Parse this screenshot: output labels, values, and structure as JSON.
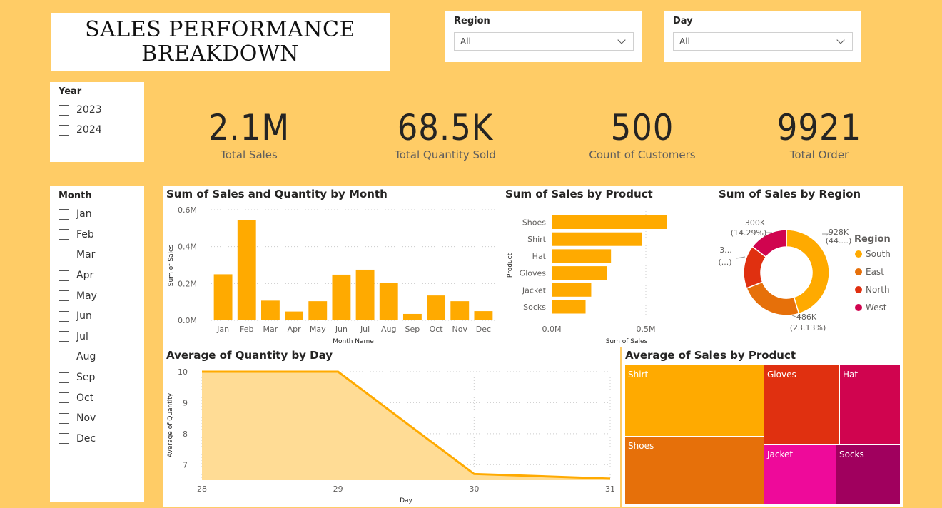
{
  "header": {
    "title_line1": "SALES PERFORMANCE",
    "title_line2": "BREAKDOWN"
  },
  "region_slicer": {
    "label": "Region",
    "value": "All"
  },
  "day_slicer": {
    "label": "Day",
    "value": "All"
  },
  "year_slicer": {
    "label": "Year",
    "options": [
      "2023",
      "2024"
    ]
  },
  "month_slicer": {
    "label": "Month",
    "options": [
      "Jan",
      "Feb",
      "Mar",
      "Apr",
      "May",
      "Jun",
      "Jul",
      "Aug",
      "Sep",
      "Oct",
      "Nov",
      "Dec"
    ]
  },
  "kpis": [
    {
      "value": "2.1M",
      "caption": "Total Sales"
    },
    {
      "value": "68.5K",
      "caption": "Total Quantity Sold"
    },
    {
      "value": "500",
      "caption": "Count of Customers"
    },
    {
      "value": "9921",
      "caption": "Total Order"
    }
  ],
  "colors": {
    "background": "#FFCC66",
    "bar": "#FFAA00",
    "south": "#FFAA00",
    "east": "#E6700A",
    "north": "#E03010",
    "west": "#D0044F",
    "jacket": "#EE0A9A",
    "socks": "#A0005E"
  },
  "chart_data": [
    {
      "type": "bar",
      "title": "Sum of Sales and Quantity by Month",
      "xlabel": "Month Name",
      "ylabel": "Sum of Sales",
      "categories": [
        "Jan",
        "Feb",
        "Mar",
        "Apr",
        "May",
        "Jun",
        "Jul",
        "Aug",
        "Sep",
        "Oct",
        "Nov",
        "Dec"
      ],
      "values": [
        250000,
        545000,
        107000,
        48000,
        104000,
        248000,
        275000,
        205000,
        35000,
        135000,
        104000,
        50000
      ],
      "yticks": [
        "0.0M",
        "0.2M",
        "0.4M",
        "0.6M"
      ],
      "ylim": [
        0,
        600000
      ]
    },
    {
      "type": "bar",
      "orientation": "horizontal",
      "title": "Sum of Sales by Product",
      "xlabel": "Sum of Sales",
      "ylabel": "Product",
      "categories": [
        "Shoes",
        "Shirt",
        "Hat",
        "Gloves",
        "Jacket",
        "Socks"
      ],
      "values": [
        610000,
        480000,
        315000,
        295000,
        210000,
        180000
      ],
      "xticks": [
        "0.0M",
        "0.5M"
      ],
      "xlim": [
        0,
        500000
      ]
    },
    {
      "type": "pie",
      "donut": true,
      "title": "Sum of Sales by Region",
      "legend_title": "Region",
      "labels": [
        "South",
        "East",
        "North",
        "West"
      ],
      "values": [
        928000,
        486000,
        334000,
        300000
      ],
      "data_labels": [
        "928K",
        "(44....)",
        "486K",
        "(23.13%)",
        "3...",
        "(...)",
        "300K",
        "(14.29%)"
      ]
    },
    {
      "type": "area",
      "title": "Average of Quantity by Day",
      "xlabel": "Day",
      "ylabel": "Average of Quantity",
      "x": [
        28,
        29,
        30,
        31
      ],
      "y": [
        10,
        10,
        6.7,
        6.55
      ],
      "yticks": [
        "10",
        "9",
        "8",
        "7"
      ],
      "xticks": [
        "28",
        "29",
        "30",
        "31"
      ]
    },
    {
      "type": "treemap",
      "title": "Average of Sales by Product",
      "labels": [
        "Shirt",
        "Shoes",
        "Gloves",
        "Hat",
        "Jacket",
        "Socks"
      ]
    }
  ]
}
